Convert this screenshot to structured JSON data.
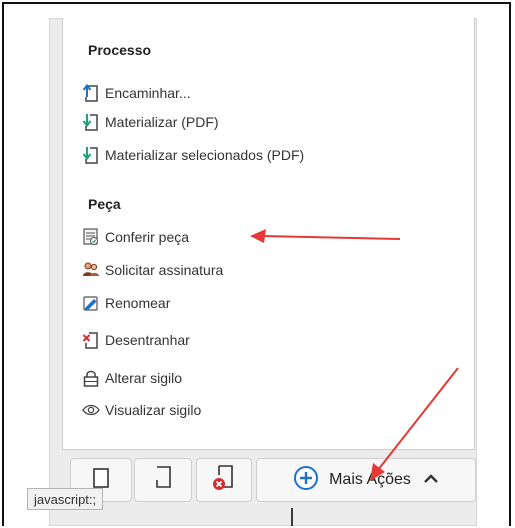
{
  "menu": {
    "sections": [
      {
        "title": "Processo",
        "items": [
          {
            "label": "Encaminhar...",
            "icon": "forward-document-icon"
          },
          {
            "label": "Materializar (PDF)",
            "icon": "download-document-icon"
          },
          {
            "label": "Materializar selecionados (PDF)",
            "icon": "download-document-icon"
          }
        ]
      },
      {
        "title": "Peça",
        "items": [
          {
            "label": "Conferir peça",
            "icon": "check-document-icon"
          },
          {
            "label": "Solicitar assinatura",
            "icon": "users-icon"
          },
          {
            "label": "Renomear",
            "icon": "rename-pencil-icon"
          },
          {
            "label": "Desentranhar",
            "icon": "remove-document-icon"
          },
          {
            "label": "Alterar sigilo",
            "icon": "lock-icon"
          },
          {
            "label": "Visualizar sigilo",
            "icon": "eye-icon"
          }
        ]
      }
    ]
  },
  "toolbar": {
    "more_actions_label": "Mais Ações"
  },
  "status_tooltip": "javascript:;",
  "colors": {
    "annotation_arrow": "#e53935",
    "plus_icon": "#1e6fd0",
    "remove_badge": "#d32f2f",
    "teal_icon": "#1aa37a"
  }
}
